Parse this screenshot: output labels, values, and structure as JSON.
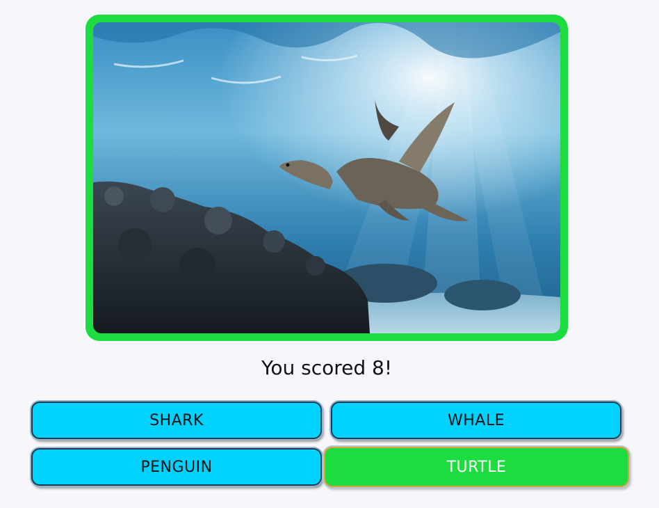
{
  "quiz": {
    "photo_subject": "sea turtle",
    "score_text": "You scored 8!",
    "answers": [
      "SHARK",
      "WHALE",
      "PENGUIN",
      "TURTLE"
    ],
    "correct_answer": "TURTLE"
  },
  "colors": {
    "frame_correct": "#1ddc3f",
    "answer_default": "#00d2ff",
    "answer_correct": "#1ddc3f"
  }
}
